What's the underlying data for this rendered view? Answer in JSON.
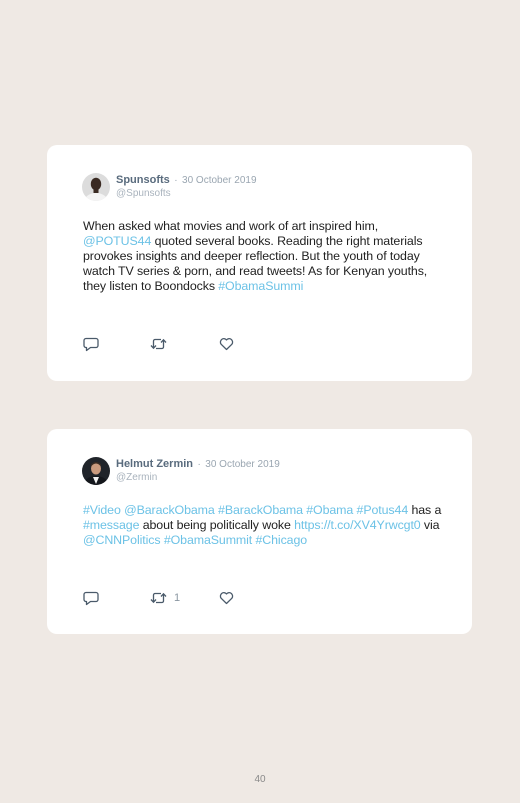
{
  "tweets": [
    {
      "author": "Spunsofts",
      "separator": "·",
      "date": "30 October 2019",
      "handle": "@Spunsofts",
      "segments": [
        {
          "t": "When asked what movies and work of art inspired him, "
        },
        {
          "t": "@POTUS44",
          "link": true
        },
        {
          "t": " quoted several books. Reading the right materials provokes insights and deeper reflection. But the youth of today watch TV series & porn, and read tweets! As for Kenyan youths, they listen to Boondocks "
        },
        {
          "t": "#ObamaSummi",
          "link": true
        }
      ],
      "retweet_count": ""
    },
    {
      "author": "Helmut Zermin",
      "separator": "·",
      "date": "30 October 2019",
      "handle": "@Zermin",
      "segments": [
        {
          "t": "#Video",
          "link": true
        },
        {
          "t": " "
        },
        {
          "t": "@BarackObama",
          "link": true
        },
        {
          "t": " "
        },
        {
          "t": "#BarackObama",
          "link": true
        },
        {
          "t": " "
        },
        {
          "t": "#Obama",
          "link": true
        },
        {
          "t": " "
        },
        {
          "t": "#Potus44",
          "link": true
        },
        {
          "t": " has a "
        },
        {
          "t": "#message",
          "link": true
        },
        {
          "t": " about being politically woke "
        },
        {
          "t": "https://t.co/XV4Yrwcgt0",
          "link": true
        },
        {
          "t": " via "
        },
        {
          "t": "@CNNPolitics",
          "link": true
        },
        {
          "t": " "
        },
        {
          "t": "#ObamaSummit",
          "link": true
        },
        {
          "t": " "
        },
        {
          "t": "#Chicago",
          "link": true
        }
      ],
      "retweet_count": "1"
    }
  ],
  "page_number": "40",
  "colors": {
    "background": "#efe9e4",
    "card": "#ffffff",
    "link": "#6cc2e6",
    "text": "#222222",
    "name": "#596b7d",
    "meta": "#9aa6b1"
  },
  "icons": [
    "reply-icon",
    "retweet-icon",
    "like-icon"
  ]
}
